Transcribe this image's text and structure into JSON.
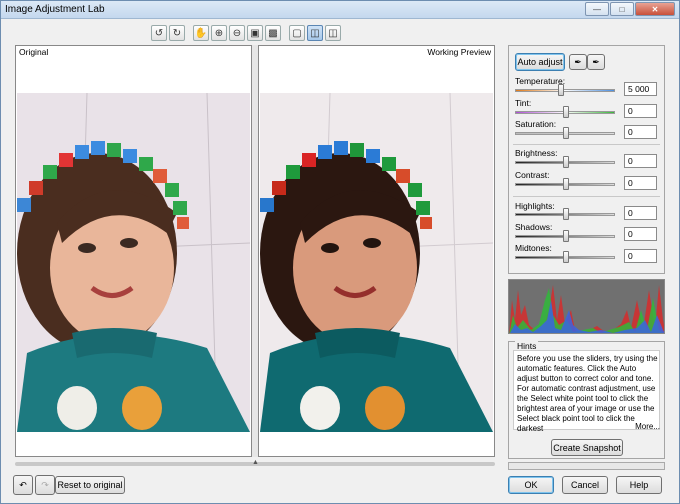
{
  "window": {
    "title": "Image Adjustment Lab",
    "buttons": [
      "minimize",
      "maximize",
      "close"
    ]
  },
  "toolbar": {
    "tools": [
      {
        "icon": "rotate-left-icon",
        "active": false
      },
      {
        "icon": "rotate-right-icon",
        "active": false
      },
      {
        "icon": "pan-hand-icon",
        "active": false
      },
      {
        "icon": "zoom-in-icon",
        "active": false
      },
      {
        "icon": "zoom-out-icon",
        "active": false
      },
      {
        "icon": "zoom-fit-icon",
        "active": false
      },
      {
        "icon": "actual-size-icon",
        "active": false
      },
      {
        "icon": "single-view-icon",
        "active": false
      },
      {
        "icon": "split-view-icon",
        "active": true
      },
      {
        "icon": "split-preview-icon",
        "active": false
      }
    ]
  },
  "panes": {
    "left_label": "Original",
    "right_label": "Working Preview"
  },
  "adjust": {
    "auto_adjust": "Auto adjust",
    "white_point_icon": "white-point-eyedropper-icon",
    "black_point_icon": "black-point-eyedropper-icon",
    "temperature": {
      "label": "Temperature:",
      "value": "5 000",
      "level": 0.45
    },
    "tint": {
      "label": "Tint:",
      "value": "0",
      "level": 0.5
    },
    "saturation": {
      "label": "Saturation:",
      "value": "0",
      "level": 0.5
    },
    "brightness": {
      "label": "Brightness:",
      "value": "0",
      "level": 0.5
    },
    "contrast": {
      "label": "Contrast:",
      "value": "0",
      "level": 0.5
    },
    "highlights": {
      "label": "Highlights:",
      "value": "0",
      "level": 0.5
    },
    "shadows": {
      "label": "Shadows:",
      "value": "0",
      "level": 0.5
    },
    "midtones": {
      "label": "Midtones:",
      "value": "0",
      "level": 0.5
    }
  },
  "hints": {
    "label": "Hints",
    "text": "Before you use the sliders, try using the automatic features. Click the Auto adjust button to correct color and tone. For automatic contrast adjustment, use the Select white point tool to click the brightest area of your image or use the Select black point tool to click the darkest",
    "more": "More..."
  },
  "create_snapshot": "Create Snapshot",
  "bottom": {
    "undo_icon": "undo-icon",
    "redo_icon": "redo-icon",
    "reset": "Reset to original",
    "ok": "OK",
    "cancel": "Cancel",
    "help": "Help"
  },
  "colors": {
    "accent": "#3c7fb1",
    "title_bar": "#c4d8ee"
  }
}
